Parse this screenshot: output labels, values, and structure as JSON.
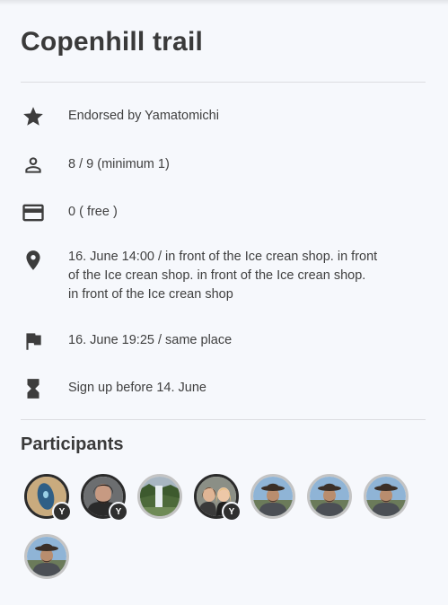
{
  "title": "Copenhill trail",
  "details": [
    {
      "icon": "star-icon",
      "text": "Endorsed by Yamatomichi"
    },
    {
      "icon": "person-icon",
      "text": "8 / 9 (minimum 1)"
    },
    {
      "icon": "credit-card-icon",
      "text": "0 ( free )"
    },
    {
      "icon": "location-pin-icon",
      "text": "16. June 14:00 / in front of the Ice crean shop. in front of the Ice crean shop. in front of the Ice crean shop. in front of the Ice crean shop"
    },
    {
      "icon": "flag-icon",
      "text": "16. June 19:25 / same place"
    },
    {
      "icon": "hourglass-icon",
      "text": "Sign up before 14. June"
    }
  ],
  "participants": {
    "heading": "Participants",
    "badge_label": "Y",
    "avatars": [
      {
        "badge": true,
        "ring": "dark",
        "photo": "blue-shield"
      },
      {
        "badge": true,
        "ring": "dark",
        "photo": "dark-haired-man"
      },
      {
        "badge": false,
        "ring": "light",
        "photo": "waterfall"
      },
      {
        "badge": true,
        "ring": "dark",
        "photo": "two-women"
      },
      {
        "badge": false,
        "ring": "light",
        "photo": "hiker-hat"
      },
      {
        "badge": false,
        "ring": "light",
        "photo": "hiker-hat"
      },
      {
        "badge": false,
        "ring": "light",
        "photo": "hiker-hat"
      },
      {
        "badge": false,
        "ring": "light",
        "photo": "hiker-hat"
      }
    ]
  },
  "colors": {
    "background": "#f6f8fc",
    "icon": "#3d3d3d",
    "badge": "#2f2f2f",
    "ring_dark": "#2b2b2b",
    "ring_light": "#c4c4c4"
  }
}
